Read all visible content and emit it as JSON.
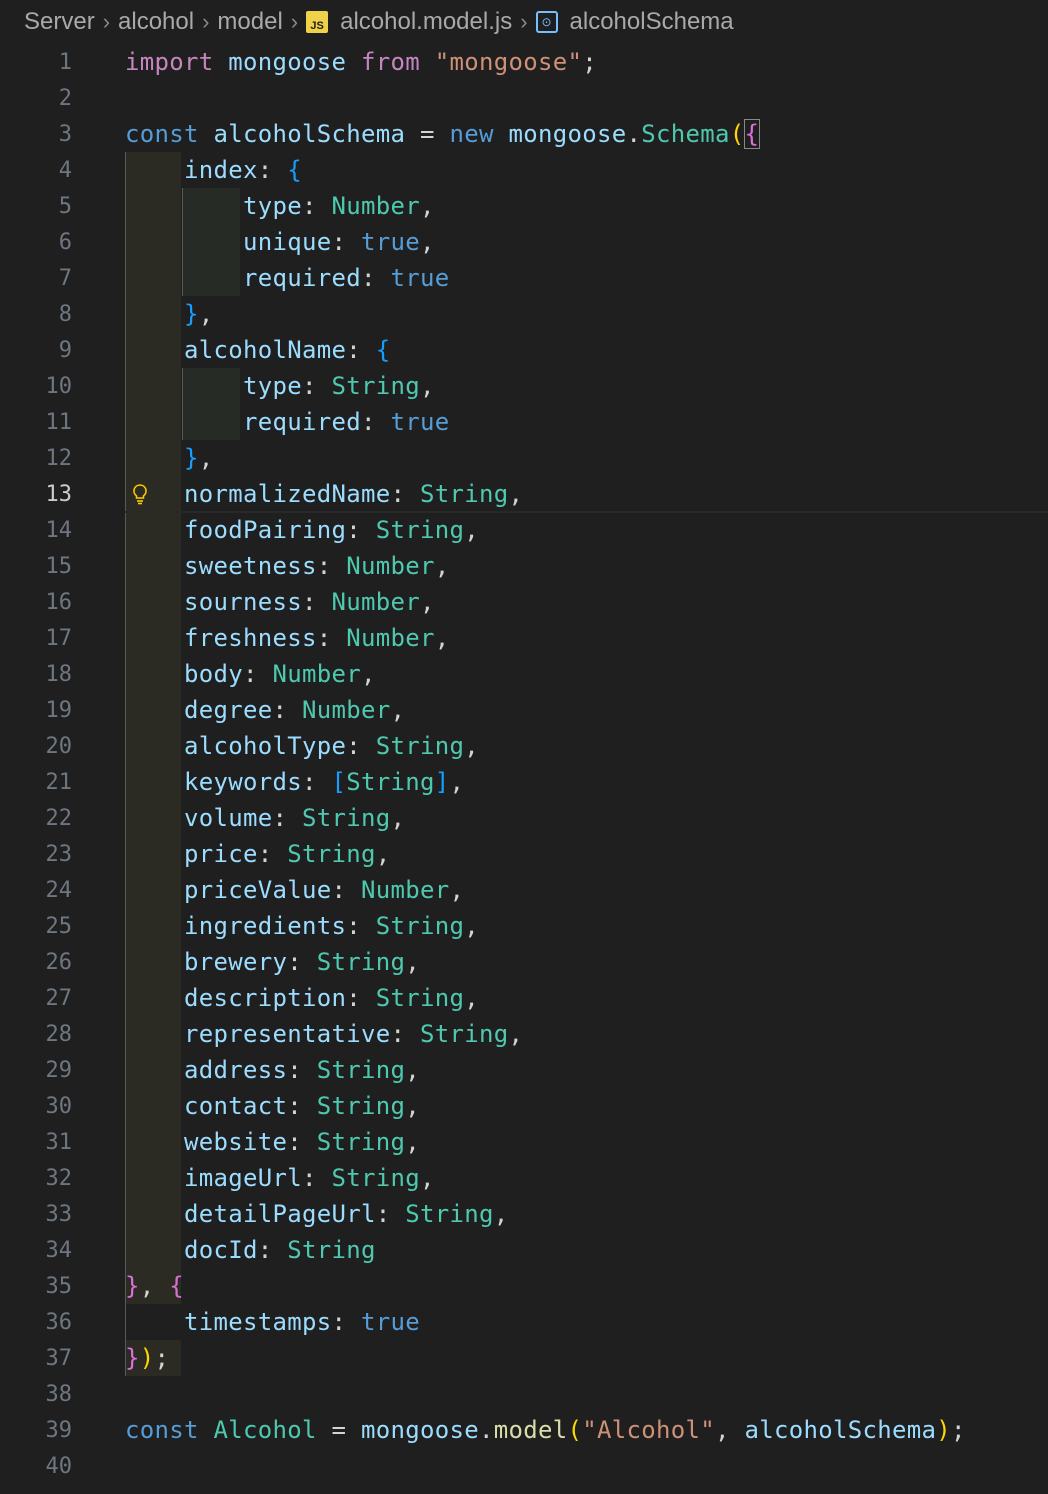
{
  "breadcrumb": {
    "items": [
      "Server",
      "alcohol",
      "model",
      "alcohol.model.js",
      "alcoholSchema"
    ],
    "js_icon_label": "JS"
  },
  "editor": {
    "line_numbers": [
      "1",
      "2",
      "3",
      "4",
      "5",
      "6",
      "7",
      "8",
      "9",
      "10",
      "11",
      "12",
      "13",
      "14",
      "15",
      "16",
      "17",
      "18",
      "19",
      "20",
      "21",
      "22",
      "23",
      "24",
      "25",
      "26",
      "27",
      "28",
      "29",
      "30",
      "31",
      "32",
      "33",
      "34",
      "35",
      "36",
      "37",
      "38",
      "39",
      "40"
    ],
    "current_line": "13",
    "tokens": {
      "import": "import",
      "mongoose": "mongoose",
      "from": "from",
      "mongoose_str": "\"mongoose\"",
      "semi": ";",
      "const": "const",
      "alcoholSchema": "alcoholSchema",
      "eq": " = ",
      "new": "new",
      "mongoose2": "mongoose",
      "dot": ".",
      "Schema": "Schema",
      "model": "model",
      "Alcohol": "Alcohol",
      "Alcohol_str": "\"Alcohol\"",
      "comma_sp": ", "
    },
    "fields": [
      {
        "key": "normalizedName",
        "type": "String",
        "end": ","
      },
      {
        "key": "foodPairing",
        "type": "String",
        "end": ","
      },
      {
        "key": "sweetness",
        "type": "Number",
        "end": ","
      },
      {
        "key": "sourness",
        "type": "Number",
        "end": ","
      },
      {
        "key": "freshness",
        "type": "Number",
        "end": ","
      },
      {
        "key": "body",
        "type": "Number",
        "end": ","
      },
      {
        "key": "degree",
        "type": "Number",
        "end": ","
      },
      {
        "key": "alcoholType",
        "type": "String",
        "end": ","
      },
      {
        "key": "keywords",
        "type": "[String]",
        "end": ","
      },
      {
        "key": "volume",
        "type": "String",
        "end": ","
      },
      {
        "key": "price",
        "type": "String",
        "end": ","
      },
      {
        "key": "priceValue",
        "type": "Number",
        "end": ","
      },
      {
        "key": "ingredients",
        "type": "String",
        "end": ","
      },
      {
        "key": "brewery",
        "type": "String",
        "end": ","
      },
      {
        "key": "description",
        "type": "String",
        "end": ","
      },
      {
        "key": "representative",
        "type": "String",
        "end": ","
      },
      {
        "key": "address",
        "type": "String",
        "end": ","
      },
      {
        "key": "contact",
        "type": "String",
        "end": ","
      },
      {
        "key": "website",
        "type": "String",
        "end": ","
      },
      {
        "key": "imageUrl",
        "type": "String",
        "end": ","
      },
      {
        "key": "detailPageUrl",
        "type": "String",
        "end": ","
      },
      {
        "key": "docId",
        "type": "String",
        "end": ""
      }
    ],
    "index_block": {
      "key": "index",
      "type_key": "type",
      "type_val": "Number",
      "unique_key": "unique",
      "unique_val": "true",
      "required_key": "required",
      "required_val": "true"
    },
    "name_block": {
      "key": "alcoholName",
      "type_key": "type",
      "type_val": "String",
      "required_key": "required",
      "required_val": "true"
    },
    "options": {
      "key": "timestamps",
      "val": "true"
    }
  }
}
